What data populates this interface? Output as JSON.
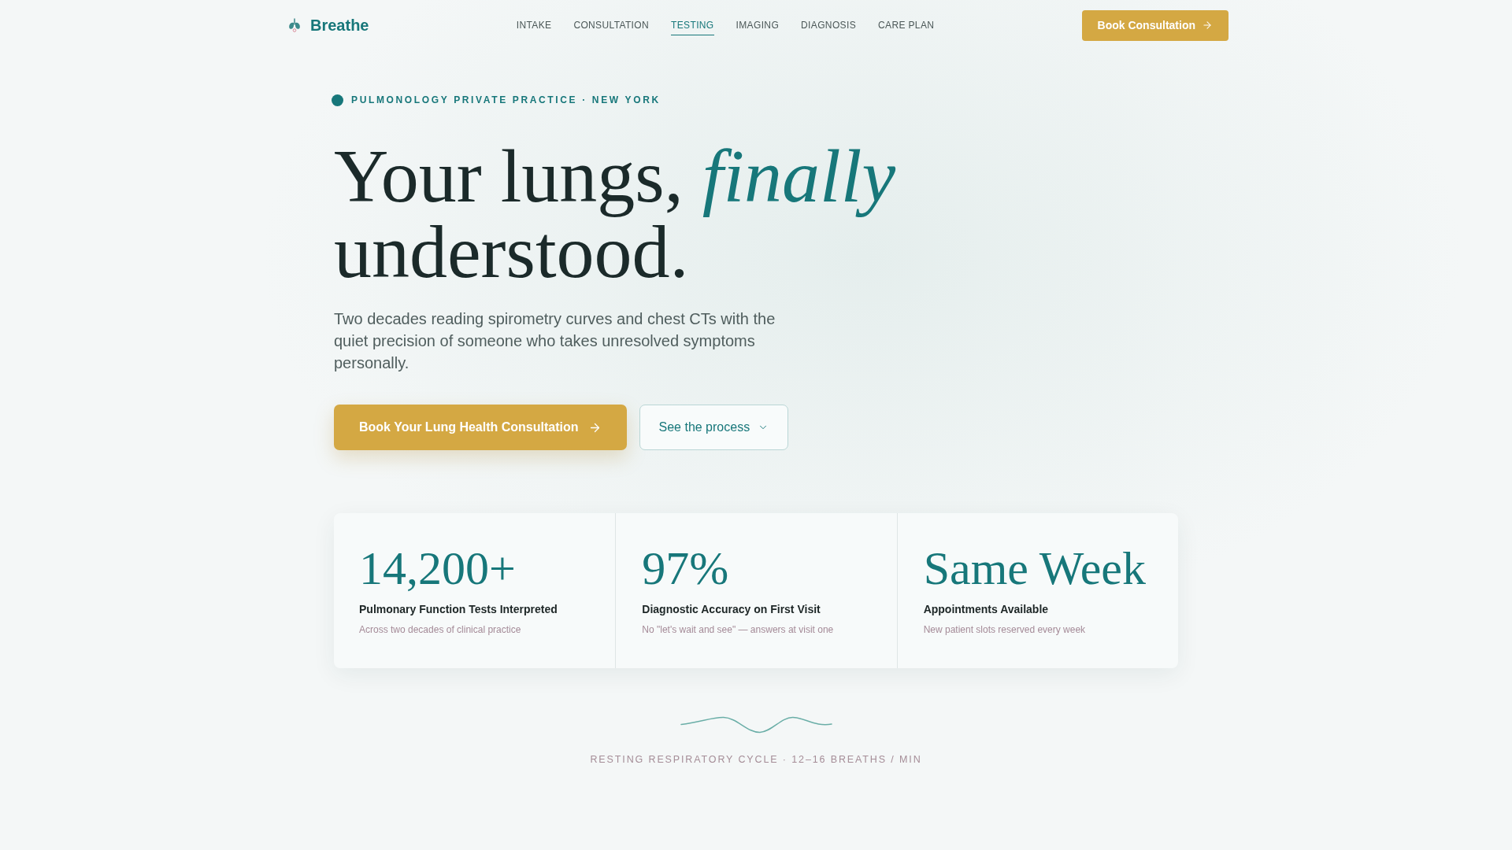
{
  "header": {
    "brand": "Breathe",
    "nav": [
      {
        "label": "INTAKE",
        "selected": false
      },
      {
        "label": "CONSULTATION",
        "selected": false
      },
      {
        "label": "TESTING",
        "selected": true
      },
      {
        "label": "IMAGING",
        "selected": false
      },
      {
        "label": "DIAGNOSIS",
        "selected": false
      },
      {
        "label": "CARE PLAN",
        "selected": false
      }
    ],
    "cta": "Book Consultation"
  },
  "hero": {
    "eyebrow": "PULMONOLOGY PRIVATE PRACTICE · NEW YORK",
    "headline": [
      "Your lungs, *finally*",
      "understood."
    ],
    "intro": "Two decades reading spirometry curves and chest CTs with the quiet precision of someone who takes unresolved symptoms personally.",
    "primary_button": "Book Your Lung Health Consultation",
    "secondary_button": "See the process"
  },
  "stats": [
    {
      "value": "14,200+",
      "label": "Pulmonary Function Tests Interpreted",
      "note": "Across two decades of clinical practice"
    },
    {
      "value": "97%",
      "label": "Diagnostic Accuracy on First Visit",
      "note": "No \"let's wait and see\" — answers at visit one"
    },
    {
      "value": "Same Week",
      "label": "Appointments Available",
      "note": "New patient slots reserved every week"
    }
  ],
  "footer": {
    "caption": "RESTING RESPIRATORY CYCLE · 12–16 BREATHS / MIN"
  }
}
